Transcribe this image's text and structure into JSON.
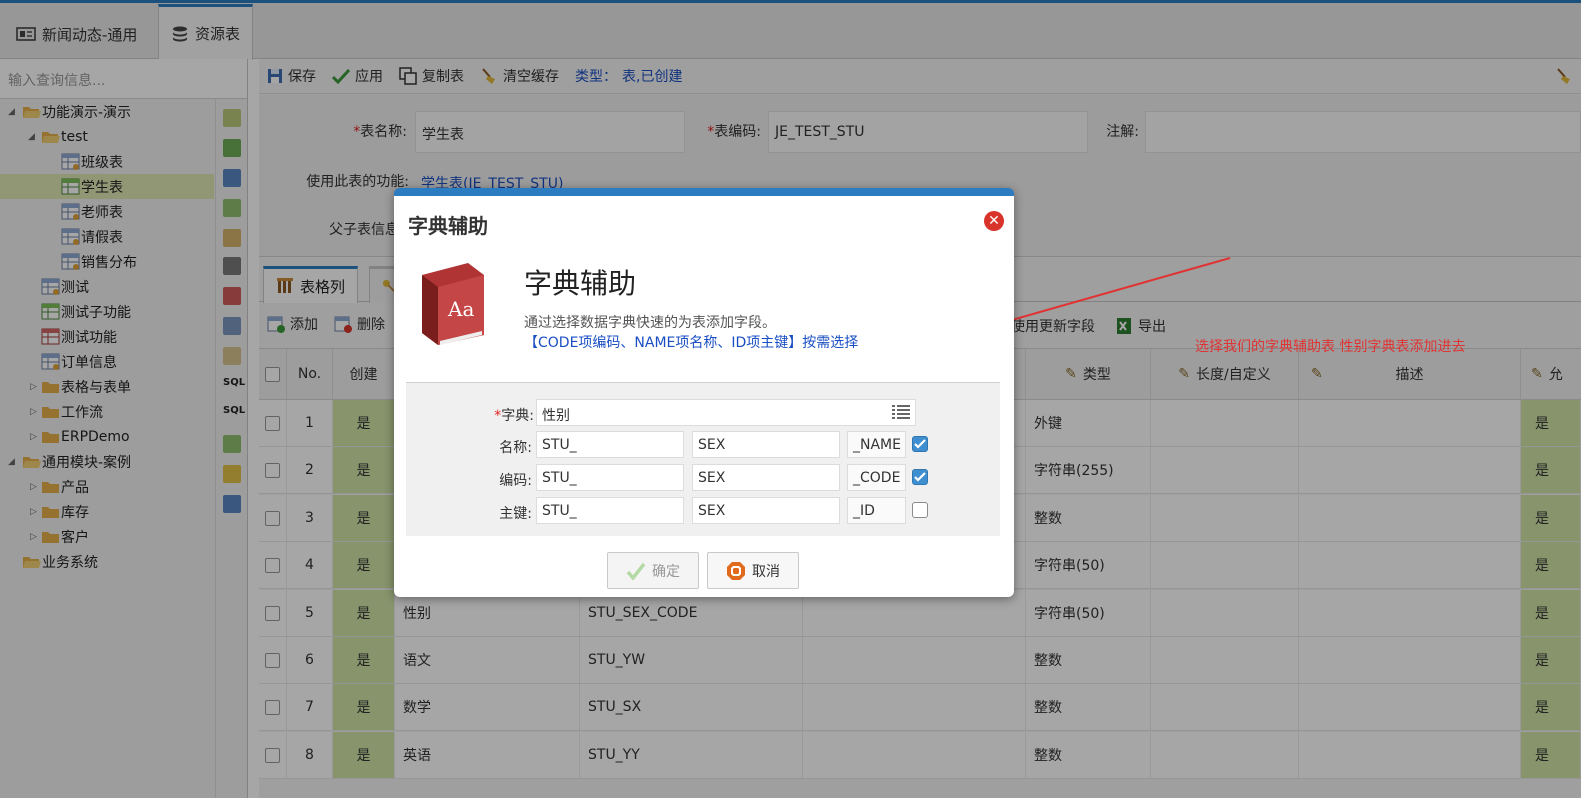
{
  "tabs": [
    {
      "label": "新闻动态-通用"
    },
    {
      "label": "资源表"
    }
  ],
  "search": {
    "placeholder": "输入查询信息..."
  },
  "tree": [
    {
      "label": "功能演示-演示"
    },
    {
      "label": "test"
    },
    {
      "label": "班级表"
    },
    {
      "label": "学生表"
    },
    {
      "label": "老师表"
    },
    {
      "label": "请假表"
    },
    {
      "label": "销售分布"
    },
    {
      "label": "测试"
    },
    {
      "label": "测试子功能"
    },
    {
      "label": "测试功能"
    },
    {
      "label": "订单信息"
    },
    {
      "label": "表格与表单"
    },
    {
      "label": "工作流"
    },
    {
      "label": "ERPDemo"
    },
    {
      "label": "通用模块-案例"
    },
    {
      "label": "产品"
    },
    {
      "label": "库存"
    },
    {
      "label": "客户"
    },
    {
      "label": "业务系统"
    }
  ],
  "toolbar": {
    "save": "保存",
    "apply": "应用",
    "copy": "复制表",
    "clear_cache": "清空缓存",
    "type_label": "类型：",
    "type_value": "表,已创建"
  },
  "form": {
    "table_name_label": "表名称:",
    "table_name": "学生表",
    "table_code_label": "表编码:",
    "table_code": "JE_TEST_STU",
    "comment_label": "注解:",
    "usage_label": "使用此表的功能:",
    "usage_value": "学生表(JE_TEST_STU)",
    "parent_label": "父子表信息"
  },
  "grid_tabs": {
    "columns": "表格列"
  },
  "grid_tools": {
    "add": "添加",
    "delete": "删除",
    "use_update": "使用更新字段",
    "export": "导出"
  },
  "grid_head": {
    "no": "No.",
    "create": "创建",
    "type": "类型",
    "length": "长度/自定义",
    "desc": "描述",
    "allow": "允"
  },
  "rows": [
    {
      "no": "1",
      "create": "是",
      "name": "",
      "code": "",
      "type": "外键",
      "allow": "是"
    },
    {
      "no": "2",
      "create": "是",
      "name": "",
      "code": "",
      "type": "字符串(255)",
      "allow": "是"
    },
    {
      "no": "3",
      "create": "是",
      "name": "",
      "code": "",
      "type": "整数",
      "allow": "是"
    },
    {
      "no": "4",
      "create": "是",
      "name": "",
      "code": "",
      "type": "字符串(50)",
      "allow": "是"
    },
    {
      "no": "5",
      "create": "是",
      "name": "性别",
      "code": "STU_SEX_CODE",
      "type": "字符串(50)",
      "allow": "是"
    },
    {
      "no": "6",
      "create": "是",
      "name": "语文",
      "code": "STU_YW",
      "type": "整数",
      "allow": "是"
    },
    {
      "no": "7",
      "create": "是",
      "name": "数学",
      "code": "STU_SX",
      "type": "整数",
      "allow": "是"
    },
    {
      "no": "8",
      "create": "是",
      "name": "英语",
      "code": "STU_YY",
      "type": "整数",
      "allow": "是"
    }
  ],
  "annotation": "选择我们的字典辅助表   性别字典表添加进去",
  "dialog": {
    "title": "字典辅助",
    "big_title": "字典辅助",
    "desc": "通过选择数据字典快速的为表添加字段。",
    "hint": "【CODE项编码、NAME项名称、ID项主键】按需选择",
    "dict_label": "字典:",
    "dict_value": "性别",
    "name_label": "名称:",
    "name_prefix": "STU_",
    "name_mid": "SEX",
    "name_suffix": "_NAME",
    "name_checked": true,
    "code_label": "编码:",
    "code_prefix": "STU_",
    "code_mid": "SEX",
    "code_suffix": "_CODE",
    "code_checked": true,
    "pk_label": "主键:",
    "pk_prefix": "STU_",
    "pk_mid": "SEX",
    "pk_suffix": "_ID",
    "pk_checked": false,
    "ok": "确定",
    "cancel": "取消"
  },
  "colors": {
    "accent": "#2c7cc1",
    "green_cell": "#cfe3a6",
    "link": "#1a4fc4",
    "annotation": "#e03333"
  }
}
